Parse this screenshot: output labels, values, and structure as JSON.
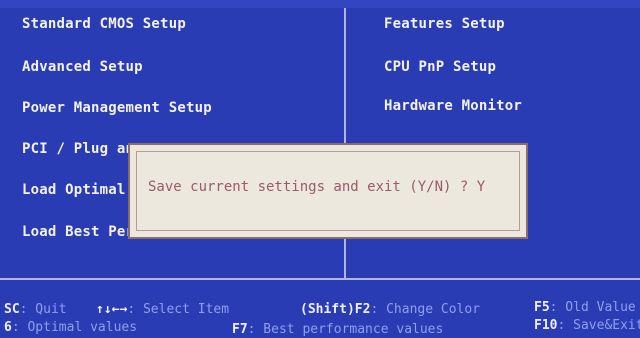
{
  "menu": {
    "left": [
      "Standard CMOS Setup",
      "Advanced Setup",
      "Power Management Setup",
      "PCI / Plug an",
      "Load Optimal",
      "Load Best Per"
    ],
    "right": [
      "Features Setup",
      "CPU PnP Setup",
      "Hardware Monitor"
    ]
  },
  "dialog": {
    "message": "Save current settings and exit (Y/N) ? Y"
  },
  "footer": {
    "row1": [
      {
        "key": "SC",
        "text": ": Quit"
      },
      {
        "key": "↑↓←→",
        "text": ": Select Item"
      },
      {
        "key": "(Shift)F2",
        "text": ": Change Color"
      },
      {
        "key": "F5",
        "text": ": Old Value"
      }
    ],
    "row2": [
      {
        "key": "6",
        "text": ": Optimal values"
      },
      {
        "key": "F7",
        "text": ": Best performance values"
      },
      {
        "key": "F10",
        "text": ": Save&Exit"
      }
    ]
  }
}
